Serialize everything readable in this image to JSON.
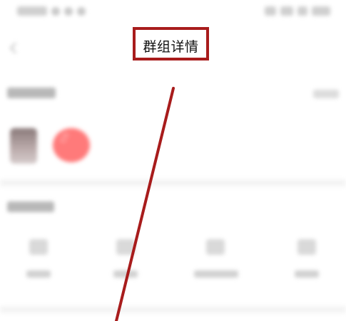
{
  "header": {
    "title": "群组详情"
  },
  "colors": {
    "highlight_box": "#a81c1c",
    "annotation_line": "#a81c1c",
    "avatar_accent": "#ff7a7a",
    "page_background": "#ffffff"
  },
  "icons": {
    "back": "chevron-left-icon"
  }
}
